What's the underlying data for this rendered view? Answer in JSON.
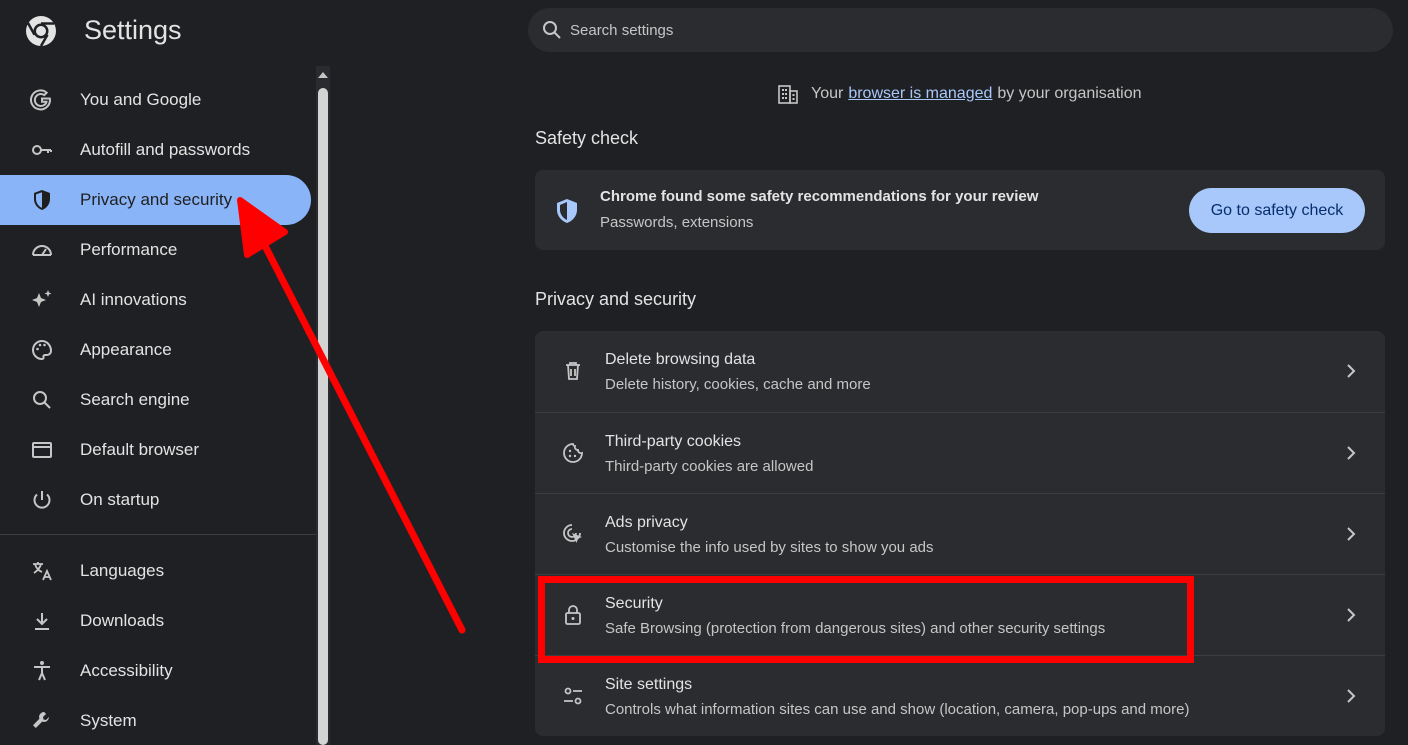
{
  "header": {
    "title": "Settings",
    "search_placeholder": "Search settings"
  },
  "sidebar": {
    "items": [
      {
        "label": "You and Google",
        "icon": "google-icon"
      },
      {
        "label": "Autofill and passwords",
        "icon": "key-icon"
      },
      {
        "label": "Privacy and security",
        "icon": "shield-icon",
        "active": true
      },
      {
        "label": "Performance",
        "icon": "speedometer-icon"
      },
      {
        "label": "AI innovations",
        "icon": "sparkle-icon"
      },
      {
        "label": "Appearance",
        "icon": "palette-icon"
      },
      {
        "label": "Search engine",
        "icon": "search-icon"
      },
      {
        "label": "Default browser",
        "icon": "browser-window-icon"
      },
      {
        "label": "On startup",
        "icon": "power-icon"
      },
      {
        "label": "Languages",
        "icon": "translate-icon"
      },
      {
        "label": "Downloads",
        "icon": "download-icon"
      },
      {
        "label": "Accessibility",
        "icon": "accessibility-icon"
      },
      {
        "label": "System",
        "icon": "wrench-icon"
      }
    ]
  },
  "managed": {
    "prefix": "Your",
    "link": "browser is managed",
    "suffix": "by your organisation"
  },
  "safety_check": {
    "section_title": "Safety check",
    "title": "Chrome found some safety recommendations for your review",
    "subtitle": "Passwords, extensions",
    "button": "Go to safety check"
  },
  "privacy": {
    "section_title": "Privacy and security",
    "rows": [
      {
        "title": "Delete browsing data",
        "subtitle": "Delete history, cookies, cache and more",
        "icon": "trash-icon"
      },
      {
        "title": "Third-party cookies",
        "subtitle": "Third-party cookies are allowed",
        "icon": "cookie-icon"
      },
      {
        "title": "Ads privacy",
        "subtitle": "Customise the info used by sites to show you ads",
        "icon": "ads-privacy-icon"
      },
      {
        "title": "Security",
        "subtitle": "Safe Browsing (protection from dangerous sites) and other security settings",
        "icon": "lock-icon"
      },
      {
        "title": "Site settings",
        "subtitle": "Controls what information sites can use and show (location, camera, pop-ups and more)",
        "icon": "tune-icon"
      }
    ]
  },
  "colors": {
    "background": "#1f2023",
    "card": "#2b2c2f",
    "accent": "#8ab4f8",
    "annotation": "#ff0000"
  }
}
